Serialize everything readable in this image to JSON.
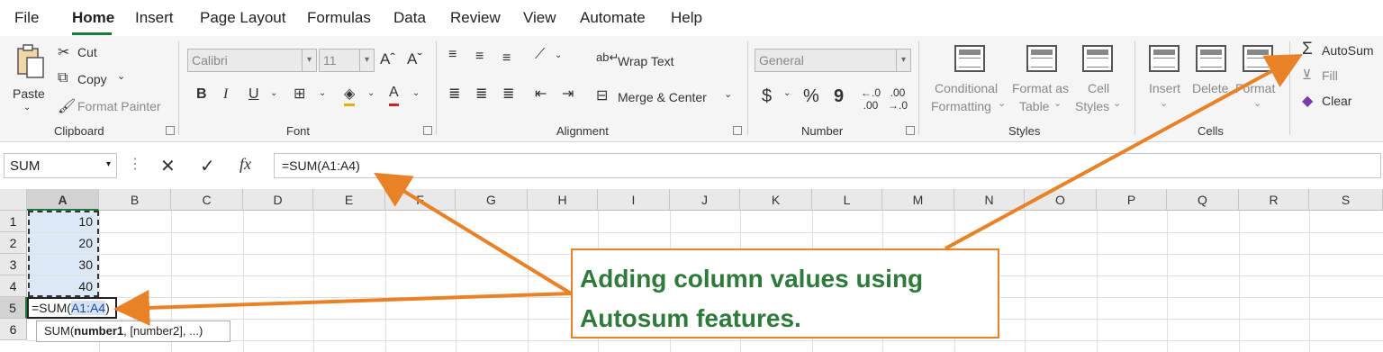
{
  "menu": [
    "File",
    "Home",
    "Insert",
    "Page Layout",
    "Formulas",
    "Data",
    "Review",
    "View",
    "Automate",
    "Help"
  ],
  "clipboard": {
    "paste": "Paste",
    "cut": "Cut",
    "copy": "Copy",
    "format_painter": "Format Painter",
    "label": "Clipboard"
  },
  "font": {
    "name": "Calibri",
    "size": "11",
    "bold": "B",
    "italic": "I",
    "underline": "U",
    "label": "Font"
  },
  "alignment": {
    "wrap": "Wrap Text",
    "merge": "Merge & Center",
    "label": "Alignment"
  },
  "number": {
    "format": "General",
    "currency": "$",
    "percent": "%",
    "comma": "9",
    "label": "Number"
  },
  "styles": {
    "conditional_line1": "Conditional",
    "conditional_line2": "Formatting",
    "table_line1": "Format as",
    "table_line2": "Table",
    "cell_line1": "Cell",
    "cell_line2": "Styles",
    "label": "Styles"
  },
  "cells": {
    "insert": "Insert",
    "delete": "Delete",
    "format": "Format",
    "label": "Cells"
  },
  "editing": {
    "autosum": "AutoSum",
    "fill": "Fill",
    "clear": "Clear"
  },
  "formula_bar": {
    "name_box": "SUM",
    "formula": "=SUM(A1:A4)",
    "fx": "fx"
  },
  "columns": [
    "A",
    "B",
    "C",
    "D",
    "E",
    "F",
    "G",
    "H",
    "I",
    "J",
    "K",
    "L",
    "M",
    "N",
    "O",
    "P",
    "Q",
    "R",
    "S"
  ],
  "rows": [
    "1",
    "2",
    "3",
    "4",
    "5",
    "6"
  ],
  "cells_data": {
    "a1": "10",
    "a2": "20",
    "a3": "30",
    "a4": "40"
  },
  "active_cell": {
    "prefix": "=SUM(",
    "ref": "A1:A4",
    "suffix": ")"
  },
  "tooltip": {
    "fn": "SUM(",
    "arg1": "number1",
    "rest": ", [number2], ...)"
  },
  "annotation": {
    "line1": "Adding column values using",
    "line2": "Autosum features."
  },
  "colors": {
    "accent_green": "#1a7a3a",
    "annotation_orange": "#e98227",
    "annotation_text": "#2e7a3a",
    "range_fill": "#dde8f6"
  }
}
